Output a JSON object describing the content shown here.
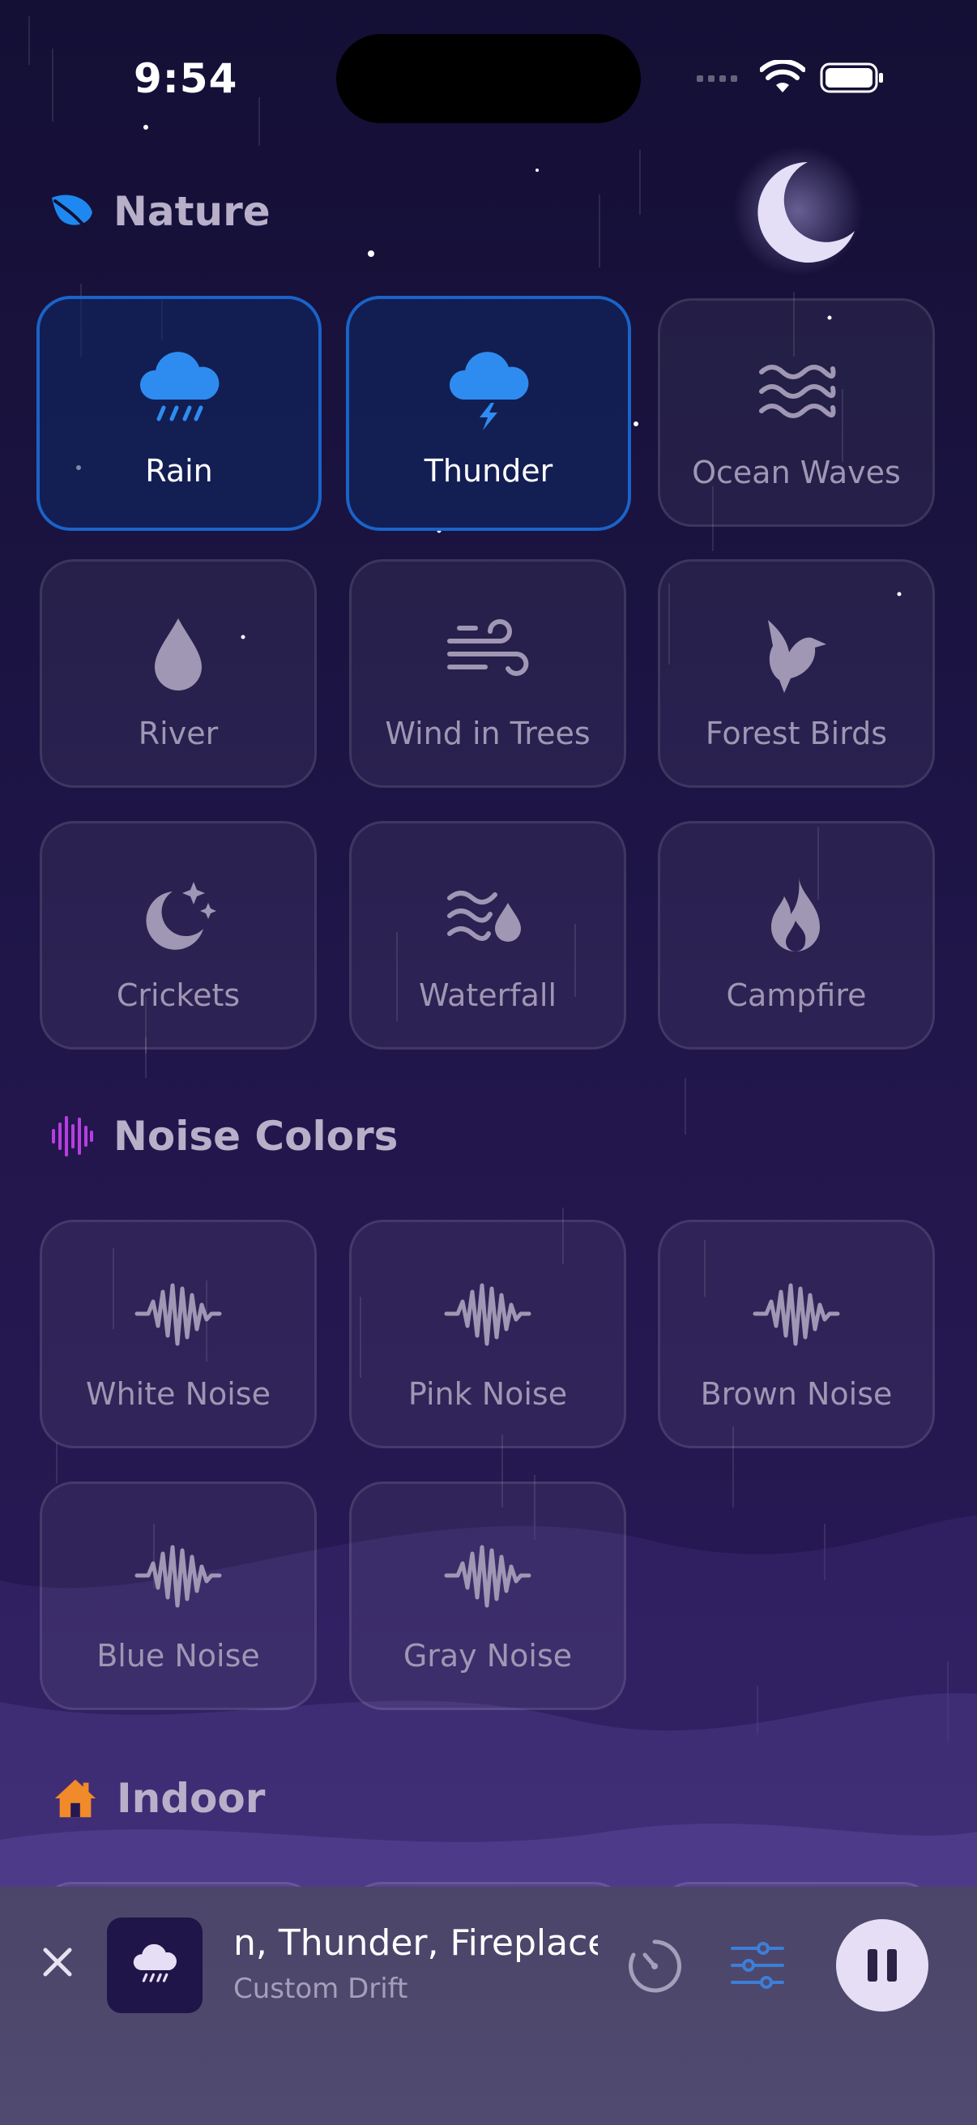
{
  "status_bar": {
    "time": "9:54"
  },
  "sections": {
    "nature": {
      "title": "Nature",
      "icon": "leaf-icon",
      "color": "#1e88f0"
    },
    "noise": {
      "title": "Noise Colors",
      "icon": "waveform-icon",
      "color": "#b63ee0"
    },
    "indoor": {
      "title": "Indoor",
      "icon": "house-icon",
      "color": "#f08a2a"
    }
  },
  "nature_tiles": [
    {
      "label": "Rain",
      "icon": "cloud-rain-icon",
      "active": true
    },
    {
      "label": "Thunder",
      "icon": "cloud-bolt-icon",
      "active": true
    },
    {
      "label": "Ocean Waves",
      "icon": "waves-icon",
      "active": false
    },
    {
      "label": "River",
      "icon": "drop-icon",
      "active": false
    },
    {
      "label": "Wind in Trees",
      "icon": "wind-icon",
      "active": false
    },
    {
      "label": "Forest Birds",
      "icon": "bird-icon",
      "active": false
    },
    {
      "label": "Crickets",
      "icon": "moon-stars-icon",
      "active": false
    },
    {
      "label": "Waterfall",
      "icon": "water-waves-drop-icon",
      "active": false
    },
    {
      "label": "Campfire",
      "icon": "flame-icon",
      "active": false
    }
  ],
  "noise_tiles": [
    {
      "label": "White Noise",
      "icon": "waveform-icon"
    },
    {
      "label": "Pink Noise",
      "icon": "waveform-icon"
    },
    {
      "label": "Brown Noise",
      "icon": "waveform-icon"
    },
    {
      "label": "Blue Noise",
      "icon": "waveform-icon"
    },
    {
      "label": "Gray Noise",
      "icon": "waveform-icon"
    }
  ],
  "player": {
    "title": "n, Thunder, Fireplace",
    "subtitle": "Custom Drift",
    "accent": "#3b7fd8"
  }
}
